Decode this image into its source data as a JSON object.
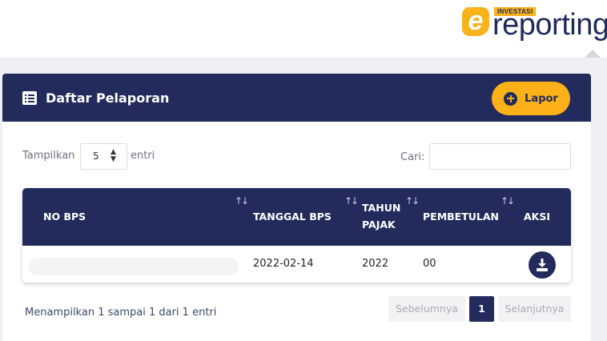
{
  "brand": {
    "logo_letter": "e",
    "badge": "INVESTASI",
    "wordmark": "reporting",
    "colors": {
      "navy": "#222b5b",
      "yellow": "#fbb117"
    }
  },
  "card": {
    "title": "Daftar Pelaporan",
    "title_icon": "list-icon",
    "lapor_label": "Lapor",
    "lapor_icon": "plus-circle-icon"
  },
  "controls": {
    "show_label": "Tampilkan",
    "page_size": "5",
    "entries_label": "entri",
    "search_label": "Cari:",
    "search_value": ""
  },
  "table": {
    "columns": [
      "NO BPS",
      "TANGGAL BPS",
      "TAHUN PAJAK",
      "PEMBETULAN",
      "AKSI"
    ],
    "col_tahun_line1": "TAHUN",
    "col_tahun_line2": "PAJAK",
    "rows": [
      {
        "no_bps": "",
        "tanggal_bps": "2022-02-14",
        "tahun_pajak": "2022",
        "pembetulan": "00",
        "aksi_icon": "download-icon"
      }
    ]
  },
  "footer": {
    "info": "Menampilkan 1 sampai 1 dari 1 entri",
    "prev": "Sebelumnya",
    "current_page": "1",
    "next": "Selanjutnya"
  }
}
